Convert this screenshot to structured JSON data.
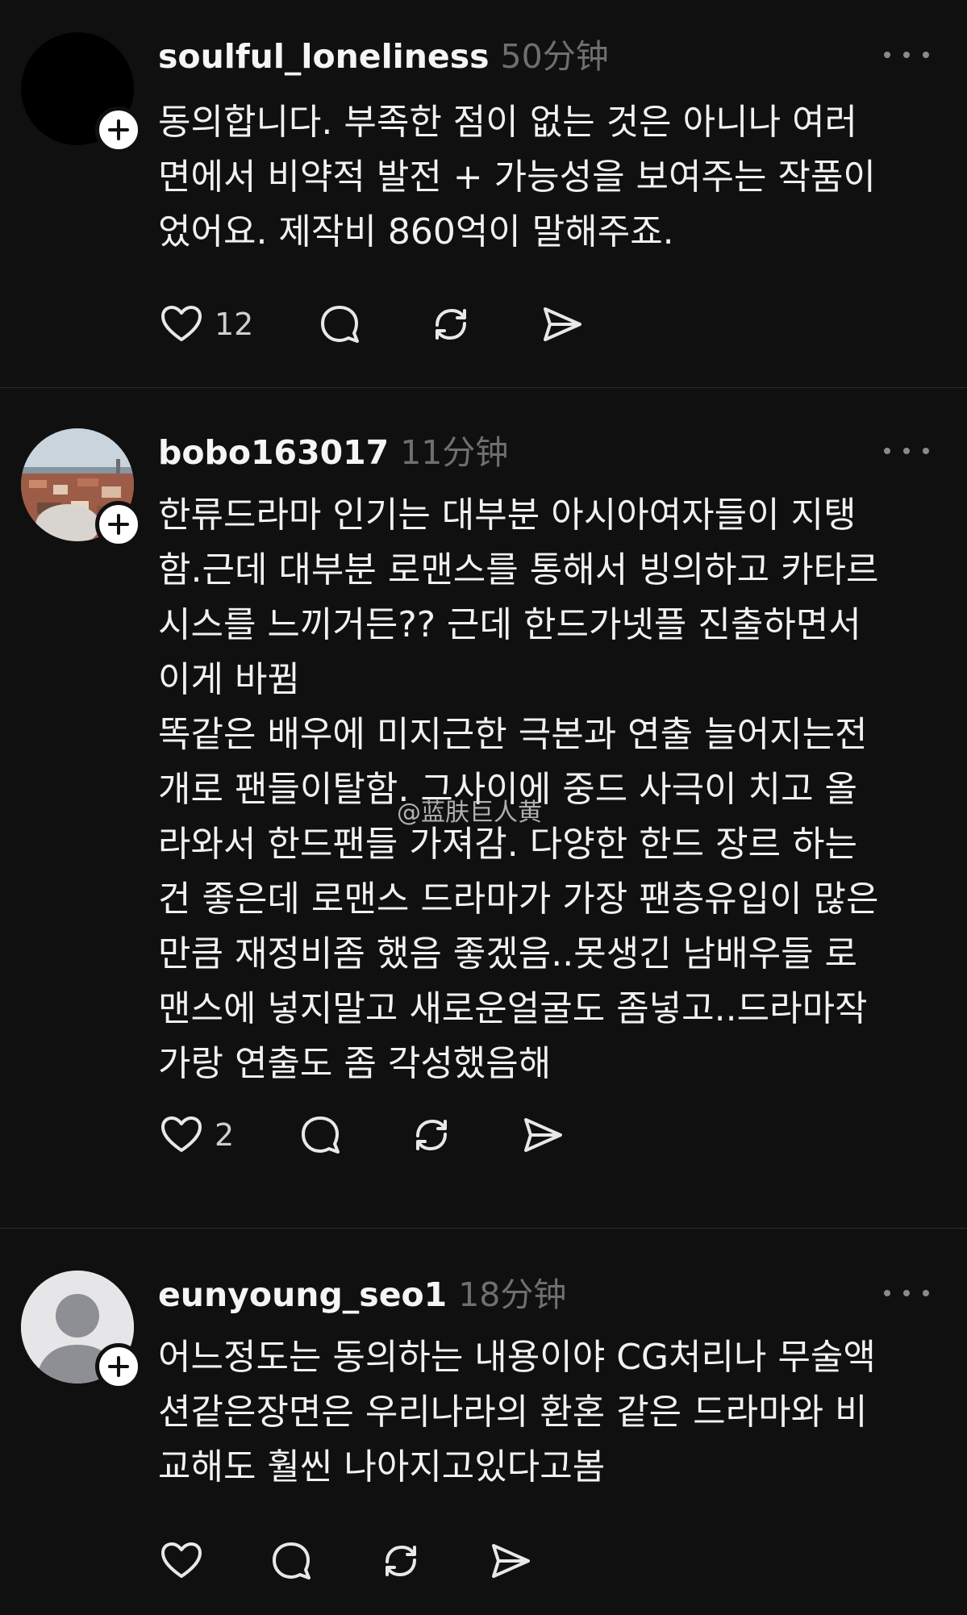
{
  "comments": [
    {
      "username": "soulful_loneliness",
      "time": "50分钟",
      "avatar": "black-circle",
      "text": "동의합니다. 부족한 점이 없는 것은 아니나 여러\n면에서 비약적 발전 + 가능성을 보여주는 작품이\n었어요. 제작비 860억이 말해주죠.",
      "likes": "12"
    },
    {
      "username": "bobo163017",
      "time": "11分钟",
      "avatar": "city-photo",
      "text": "한류드라마 인기는 대부분 아시아여자들이 지탱\n함.근데 대부분 로맨스를 통해서 빙의하고 카타르\n시스를 느끼거든?? 근데 한드가넷플 진출하면서\n이게 바뀜\n똑같은 배우에 미지근한 극본과 연출 늘어지는전\n개로 팬들이탈함. 그사이에 중드 사극이 치고 올\n라와서 한드팬들 가져감. 다양한 한드 장르 하는\n건 좋은데 로맨스 드라마가 가장 팬층유입이 많은\n만큼 재정비좀 했음 좋겠음..못생긴 남배우들 로\n맨스에 넣지말고 새로운얼굴도 좀넣고..드라마작\n가랑 연출도 좀 각성했음해",
      "likes": "2"
    },
    {
      "username": "eunyoung_seo1",
      "time": "18分钟",
      "avatar": "default-person",
      "text": "어느정도는 동의하는 내용이야 CG처리나 무술액\n션같은장면은 우리나라의 환혼 같은 드라마와 비\n교해도 훨씬 나아지고있다고봄",
      "likes": ""
    }
  ],
  "watermark": "@蓝肤巨人黄",
  "colors": {
    "background": "#101010",
    "text": "#f1f1f1",
    "muted": "#6f6f6f",
    "divider": "#2c2c2c"
  },
  "icons": [
    "heart-icon",
    "comment-icon",
    "repost-icon",
    "share-icon",
    "more-icon",
    "plus-icon"
  ]
}
